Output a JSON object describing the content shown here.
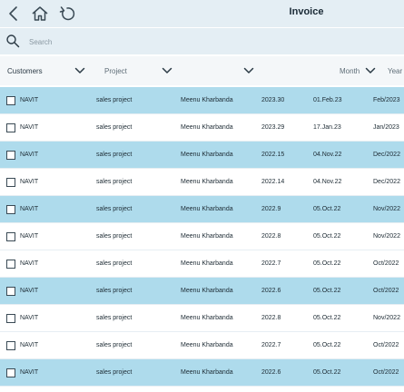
{
  "header": {
    "title": "Invoice",
    "icons": [
      "back-icon",
      "home-icon",
      "refresh-icon"
    ]
  },
  "search": {
    "placeholder": "Search"
  },
  "filters": {
    "customers_label": "Customers",
    "project_label": "Project",
    "month_label": "Month",
    "year_label": "Year"
  },
  "colors": {
    "header_bg": "#e4eef4",
    "row_highlight": "#aedbec"
  },
  "rows": [
    {
      "customer": "NAVIT",
      "project": "sales project",
      "user": "Meenu Kharbanda",
      "number": "2023.30",
      "date": "01.Feb.23",
      "month": "Feb/2023",
      "highlighted": true
    },
    {
      "customer": "NAVIT",
      "project": "sales project",
      "user": "Meenu Kharbanda",
      "number": "2023.29",
      "date": "17.Jan.23",
      "month": "Jan/2023",
      "highlighted": false
    },
    {
      "customer": "NAVIT",
      "project": "sales project",
      "user": "Meenu Kharbanda",
      "number": "2022.15",
      "date": "04.Nov.22",
      "month": "Dec/2022",
      "highlighted": true
    },
    {
      "customer": "NAVIT",
      "project": "sales project",
      "user": "Meenu Kharbanda",
      "number": "2022.14",
      "date": "04.Nov.22",
      "month": "Dec/2022",
      "highlighted": false
    },
    {
      "customer": "NAVIT",
      "project": "sales project",
      "user": "Meenu Kharbanda",
      "number": "2022.9",
      "date": "05.Oct.22",
      "month": "Nov/2022",
      "highlighted": true
    },
    {
      "customer": "NAVIT",
      "project": "sales project",
      "user": "Meenu Kharbanda",
      "number": "2022.8",
      "date": "05.Oct.22",
      "month": "Nov/2022",
      "highlighted": false
    },
    {
      "customer": "NAVIT",
      "project": "sales project",
      "user": "Meenu Kharbanda",
      "number": "2022.7",
      "date": "05.Oct.22",
      "month": "Oct/2022",
      "highlighted": false
    },
    {
      "customer": "NAVIT",
      "project": "sales project",
      "user": "Meenu Kharbanda",
      "number": "2022.6",
      "date": "05.Oct.22",
      "month": "Oct/2022",
      "highlighted": true
    },
    {
      "customer": "NAVIT",
      "project": "sales project",
      "user": "Meenu Kharbanda",
      "number": "2022.8",
      "date": "05.Oct.22",
      "month": "Nov/2022",
      "highlighted": false
    },
    {
      "customer": "NAVIT",
      "project": "sales project",
      "user": "Meenu Kharbanda",
      "number": "2022.7",
      "date": "05.Oct.22",
      "month": "Oct/2022",
      "highlighted": false
    },
    {
      "customer": "NAVIT",
      "project": "sales project",
      "user": "Meenu Kharbanda",
      "number": "2022.6",
      "date": "05.Oct.22",
      "month": "Oct/2022",
      "highlighted": true
    }
  ]
}
